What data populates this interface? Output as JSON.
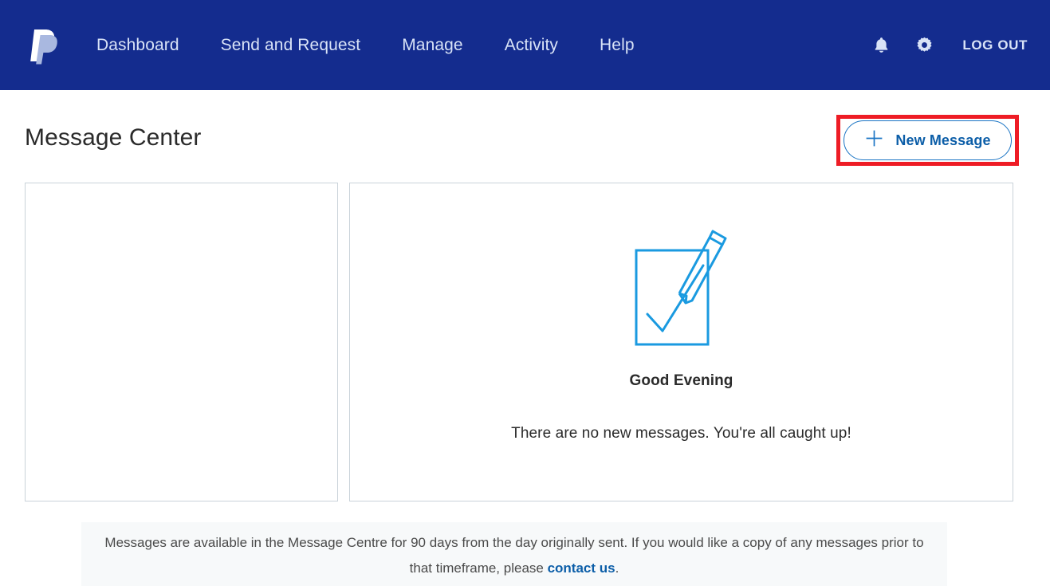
{
  "header": {
    "logo_name": "paypal-logo",
    "nav_items": [
      {
        "label": "Dashboard",
        "name": "nav-item-dashboard"
      },
      {
        "label": "Send and Request",
        "name": "nav-item-send-and-request"
      },
      {
        "label": "Manage",
        "name": "nav-item-manage"
      },
      {
        "label": "Activity",
        "name": "nav-item-activity"
      },
      {
        "label": "Help",
        "name": "nav-item-help"
      }
    ],
    "notifications_icon": "bell-icon",
    "settings_icon": "gear-icon",
    "logout_label": "LOG OUT",
    "background_color": "#142c8e",
    "text_color": "#d9e3f7"
  },
  "page": {
    "title": "Message Center"
  },
  "new_message": {
    "label": "New Message",
    "plus_icon": "plus-icon",
    "border_color": "#1a74c4",
    "text_color": "#0c5ea8",
    "highlight_color": "#ee1c25"
  },
  "panels": {
    "list_panel_name": "message-list-panel",
    "detail_panel_name": "message-detail-panel",
    "border_color": "#c9d2d9"
  },
  "empty_state": {
    "illustration_icon": "note-and-pencil-icon",
    "illustration_color": "#1a9ae0",
    "greeting": "Good Evening",
    "message": "There are no new messages. You're all caught up!"
  },
  "footer": {
    "text_before_link": "Messages are available in the Message Centre for 90 days from the day originally sent. If you would like a copy of any messages prior to that timeframe, please ",
    "link_label": "contact us",
    "text_after_link": ".",
    "background_color": "#f7f9fa",
    "link_color": "#0c5ea8"
  }
}
